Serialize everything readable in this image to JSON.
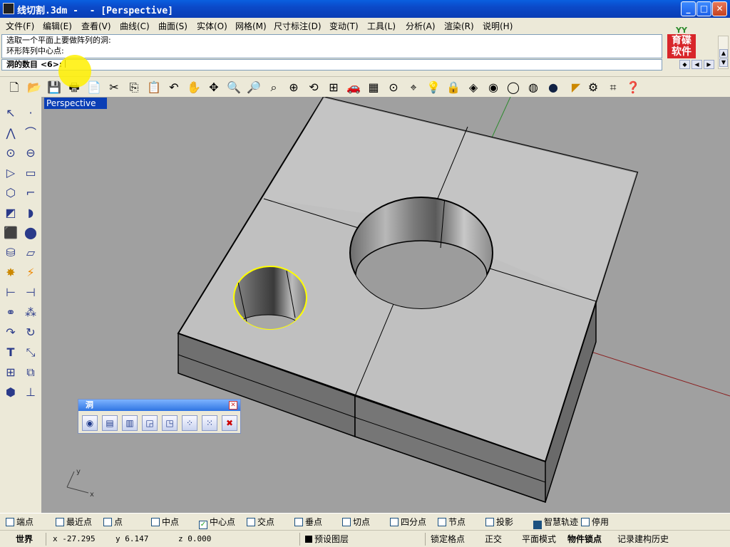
{
  "window": {
    "title": "线切割.3dm -  - [Perspective]",
    "buttons": {
      "minimize": "_",
      "maximize": "□",
      "close": "✕"
    }
  },
  "menu": [
    "文件(F)",
    "编辑(E)",
    "查看(V)",
    "曲线(C)",
    "曲面(S)",
    "实体(O)",
    "网格(M)",
    "尺寸标注(D)",
    "变动(T)",
    "工具(L)",
    "分析(A)",
    "渲染(R)",
    "说明(H)"
  ],
  "command": {
    "history": [
      "选取一个平面上要做阵列的洞:",
      "环形阵列中心点:"
    ],
    "prompt": "洞的数目 <6>:"
  },
  "logo": {
    "top": "YY",
    "line1": "育碟",
    "line2": "软件"
  },
  "toolbar": {
    "icons": [
      "new-icon",
      "open-icon",
      "save-icon",
      "print-icon",
      "import-icon",
      "cut-icon",
      "copy-icon",
      "paste-icon",
      "undo-icon",
      "pan-icon",
      "rotate-view-icon",
      "zoom-icon",
      "zoom-window-icon",
      "zoom-extents-icon",
      "zoom-selected-icon",
      "rotate-icon",
      "four-view-icon",
      "car-icon",
      "grid-icon",
      "point-icon",
      "osnap-icon",
      "light-icon",
      "lock-icon",
      "layer-icon",
      "color-icon",
      "wireframe-icon",
      "shaded-icon",
      "render-icon",
      "paint-icon",
      "gear-icon",
      "options-icon",
      "help-icon"
    ]
  },
  "viewport": {
    "name": "Perspective",
    "axis_y": "y",
    "axis_x": "x"
  },
  "palette": {
    "title": "洞",
    "close": "✕",
    "buttons": [
      "hole-round-icon",
      "hole-rect-icon",
      "hole-cyl-icon",
      "hole-move-icon",
      "hole-rotate-icon",
      "array-rect-icon",
      "array-polar-icon",
      "hole-delete-icon"
    ]
  },
  "osnaps": [
    {
      "label": "端点",
      "checked": false
    },
    {
      "label": "最近点",
      "checked": false
    },
    {
      "label": "点",
      "checked": false
    },
    {
      "label": "中点",
      "checked": false
    },
    {
      "label": "中心点",
      "checked": true
    },
    {
      "label": "交点",
      "checked": false
    },
    {
      "label": "垂点",
      "checked": false
    },
    {
      "label": "切点",
      "checked": false
    },
    {
      "label": "四分点",
      "checked": false
    },
    {
      "label": "节点",
      "checked": false
    },
    {
      "label": "投影",
      "checked": false
    },
    {
      "label": "智慧轨迹",
      "checked": true
    },
    {
      "label": "停用",
      "checked": false
    }
  ],
  "status": {
    "world": "世界",
    "x": "x -27.295",
    "y": "y 6.147",
    "z": "z 0.000",
    "layer": "预设图层",
    "grid_snap": "锁定格点",
    "ortho": "正交",
    "planar": "平面模式",
    "osnap": "物件锁点",
    "history": "记录建构历史"
  }
}
